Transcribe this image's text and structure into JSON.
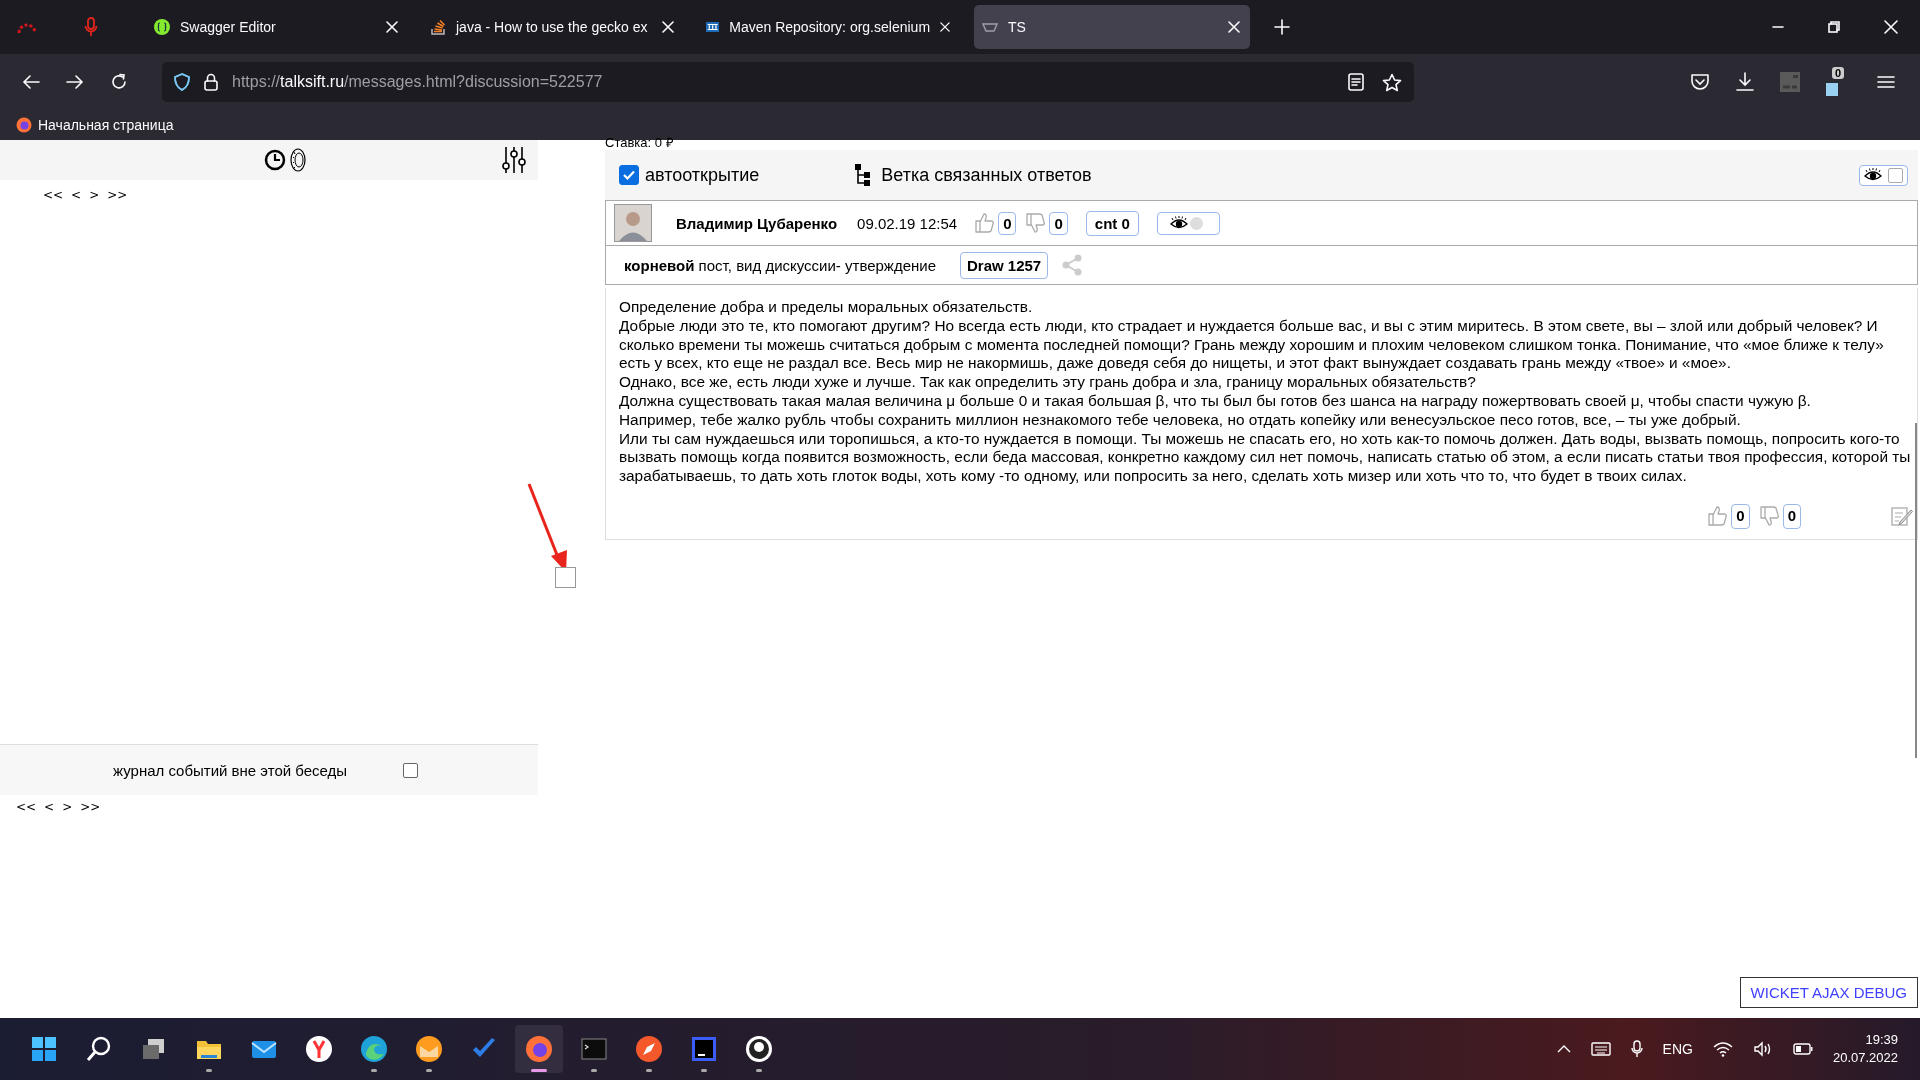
{
  "browser": {
    "tabs": [
      {
        "title": "Swagger Editor",
        "kind": "swagger",
        "selected": false
      },
      {
        "title": "java - How to use the gecko ex",
        "kind": "stack",
        "selected": false
      },
      {
        "title": "Maven Repository: org.selenium",
        "kind": "maven",
        "selected": false
      },
      {
        "title": "TS",
        "kind": "ts",
        "selected": true
      }
    ],
    "url": {
      "scheme": "https://",
      "domain": "talksift.ru",
      "path": "/messages.html?discussion=522577"
    },
    "extension_badge": "0",
    "bookmarks": [
      "Начальная страница"
    ]
  },
  "left_panel": {
    "pager_top": [
      "<<",
      "<",
      ">",
      ">>"
    ],
    "events_log": {
      "label": "журнал событий вне этой беседы",
      "checked": false
    },
    "pager_bottom": [
      "<<",
      "<",
      ">",
      ">>"
    ],
    "marker_checkbox": {
      "checked": false
    }
  },
  "right_panel": {
    "stake": "Ставка: 0 ₽",
    "autoopen": {
      "label": "автооткрытие",
      "checked": true
    },
    "branch_label": "Ветка связанных ответов",
    "eye_toggle": {
      "checked": false
    },
    "message": {
      "author": "Владимир Цубаренко",
      "date": "09.02.19 12:54",
      "likes": "0",
      "dislikes": "0",
      "count": "cnt 0",
      "eye_toggle": {
        "on": false
      },
      "type_text": "**корневой** пост, вид дискуссии- утверждение",
      "draw_button": "Draw 1257",
      "paragraphs": [
        "Определение добра и пределы моральных обязательств.",
        "Добрые люди это те, кто помогают другим? Но всегда есть люди, кто страдает и нуждается больше вас, и вы с этим миритесь. В этом свете, вы – злой или добрый человек? И сколько времени ты можешь считаться добрым с момента последней помощи? Грань между хорошим и плохим человеком слишком тонка. Понимание, что «мое ближе к телу» есть у всех, кто еще не раздал все. Весь мир не накормишь, даже доведя себя до нищеты, и этот факт вынуждает создавать грань между «твое» и «мое».",
        "Однако, все же, есть люди хуже и лучше. Так как определить эту грань добра и зла, границу моральных обязательств?",
        "Должна существовать такая малая величина μ больше 0 и такая большая β, что ты был бы готов без шанса на награду пожертвовать своей μ, чтобы спасти чужую β.",
        "Например, тебе жалко рубль чтобы сохранить миллион незнакомого тебе человека, но отдать копейку или венесуэльское песо готов, все, – ты уже добрый.",
        "Или ты сам нуждаешься или торопишься, а кто-то нуждается в помощи. Ты можешь не спасать его, но хоть как-то помочь должен. Дать воды, вызвать помощь, попросить кого-то вызвать помощь когда появится возможность, если беда массовая, конкретно каждому сил нет помочь, написать статью об этом, а если писать статьи твоя профессия, которой ты зарабатываешь, то дать хоть глоток воды, хоть кому -то одному, или попросить за него, сделать хоть мизер или хоть что то, что будет в твоих силах."
      ],
      "footer_likes": "0",
      "footer_dislikes": "0"
    }
  },
  "debug_button": "WICKET AJAX DEBUG",
  "taskbar": {
    "apps": [
      {
        "kind": "start",
        "running": false,
        "active": false
      },
      {
        "kind": "search",
        "running": false,
        "active": false
      },
      {
        "kind": "windows",
        "running": false,
        "active": false
      },
      {
        "kind": "folder",
        "running": true,
        "active": false
      },
      {
        "kind": "mail",
        "running": false,
        "active": false
      },
      {
        "kind": "yandex",
        "running": false,
        "active": false
      },
      {
        "kind": "edge",
        "running": true,
        "active": false
      },
      {
        "kind": "orange",
        "running": true,
        "active": false
      },
      {
        "kind": "check",
        "running": false,
        "active": false
      },
      {
        "kind": "firefox",
        "running": true,
        "active": true
      },
      {
        "kind": "terminal",
        "running": true,
        "active": false
      },
      {
        "kind": "compass",
        "running": true,
        "active": false
      },
      {
        "kind": "ide",
        "running": true,
        "active": false
      },
      {
        "kind": "round",
        "running": true,
        "active": false
      }
    ],
    "language": "ENG",
    "time": "19:39",
    "date": "20.07.2022"
  }
}
